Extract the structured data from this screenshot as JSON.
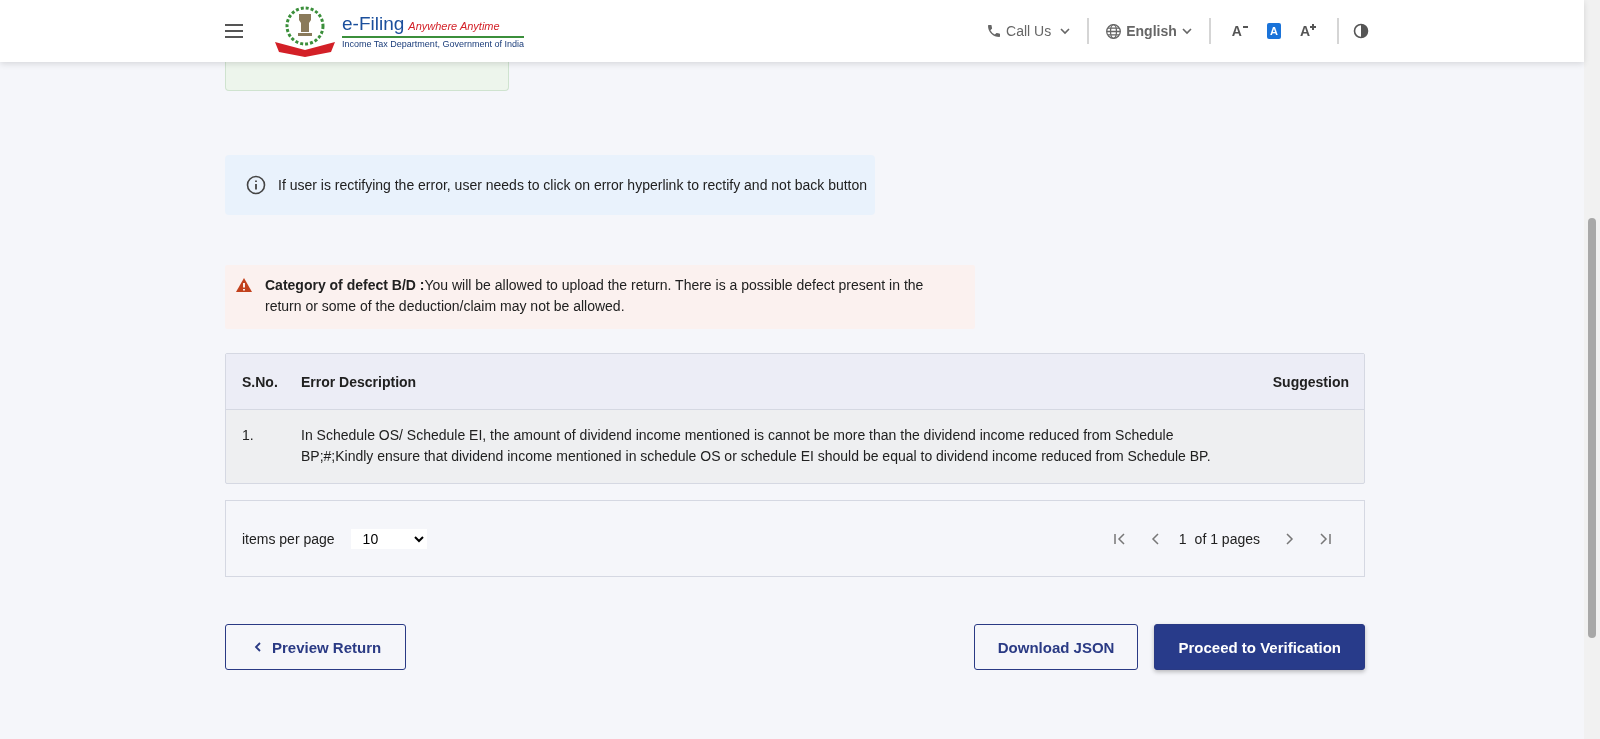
{
  "header": {
    "logo": {
      "title": "e-Filing",
      "tagline": "Anywhere Anytime",
      "subtitle": "Income Tax Department, Government of India"
    },
    "call_us": "Call Us",
    "language": "English",
    "font_controls": [
      {
        "label": "A",
        "kind": "decrease",
        "selected": false
      },
      {
        "label": "A",
        "kind": "default",
        "selected": true
      },
      {
        "label": "A",
        "kind": "increase",
        "selected": false
      }
    ]
  },
  "info_banner": {
    "text": "If user is rectifying the error, user needs to click on error hyperlink to rectify and not back button"
  },
  "defect_banner": {
    "text": "**Category of defect B/D :**You will be allowed to upload the return. There is a possible defect present in the return or some of the deduction/claim may not be allowed."
  },
  "table": {
    "columns": [
      "S.No.",
      "Error Description",
      "Suggestion"
    ],
    "rows": [
      [
        "1.",
        "In Schedule OS/ Schedule EI, the amount of dividend income mentioned is cannot be more than the dividend income reduced from Schedule BP;#;Kindly ensure that dividend income mentioned in schedule OS or schedule EI should be equal to dividend income reduced from Schedule BP.",
        ""
      ]
    ]
  },
  "pagination": {
    "items_per_page_label": "items per page",
    "items_per_page": "10",
    "current_page": "1",
    "page_total": "of 1 pages"
  },
  "buttons": [
    {
      "label": "Preview Return",
      "kind": "back"
    },
    {
      "label": "Download JSON",
      "kind": "outline"
    },
    {
      "label": "Proceed to Verification",
      "kind": "primary"
    }
  ]
}
